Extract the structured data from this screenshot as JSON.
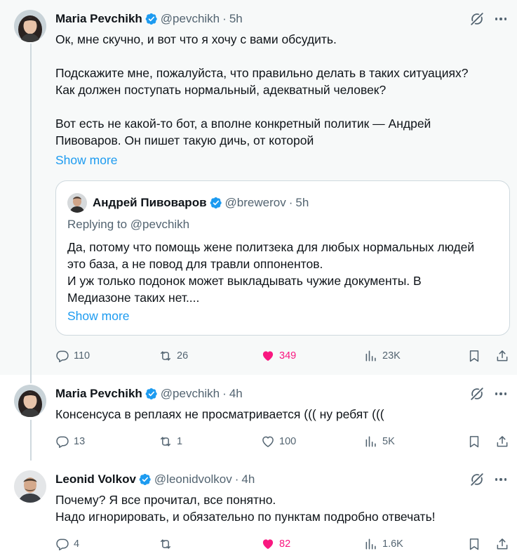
{
  "tweets": [
    {
      "author": {
        "name": "Maria Pevchikh",
        "handle": "@pevchikh",
        "time": "5h"
      },
      "text": {
        "p1": "Ок, мне скучно, и вот что я хочу с вами обсудить.",
        "p2a": "Подскажите мне, пожалуйста, что правильно делать в таких ситуациях?",
        "p2b": "Как должен поступать нормальный, адекватный человек?",
        "p3a": "Вот есть не какой-то бот, а вполне конкретный политик — Андрей",
        "p3b": "Пивоваров. Он пишет такую дичь, от которой"
      },
      "show_more": "Show more",
      "quote": {
        "author": {
          "name": "Андрей Пивоваров",
          "handle": "@brewerov",
          "time": "5h"
        },
        "replying_to": "Replying to @pevchikh",
        "lines": [
          "Да, потому что помощь жене политзека для любых нормальных людей",
          "это база, а не повод для травли оппонентов.",
          "И уж только подонок может выкладывать чужие документы. В",
          "Медиазоне таких нет...."
        ],
        "show_more": "Show more"
      },
      "stats": {
        "replies": "110",
        "reposts": "26",
        "likes": "349",
        "views": "23K"
      },
      "liked": true
    },
    {
      "author": {
        "name": "Maria Pevchikh",
        "handle": "@pevchikh",
        "time": "4h"
      },
      "text": {
        "p1": "Консенсуса в реплаях не просматривается ((( ну ребят ((("
      },
      "stats": {
        "replies": "13",
        "reposts": "1",
        "likes": "100",
        "views": "5K"
      },
      "liked": false
    },
    {
      "author": {
        "name": "Leonid Volkov",
        "handle": "@leonidvolkov",
        "time": "4h"
      },
      "text": {
        "p1": "Почему? Я все прочитал, все понятно.",
        "p2": "Надо игнорировать, и обязательно по пунктам подробно отвечать!"
      },
      "stats": {
        "replies": "4",
        "reposts": "",
        "likes": "82",
        "views": "1.6K"
      },
      "liked": true
    }
  ],
  "separator": "·",
  "colors": {
    "accent": "#1d9bf0",
    "like": "#f91880",
    "muted": "#536471",
    "border": "#cfd9de",
    "highlight_bg": "#f7f9f9"
  },
  "icons": [
    "verified-badge-icon",
    "grok-icon",
    "more-icon",
    "reply-icon",
    "repost-icon",
    "like-icon",
    "views-icon",
    "bookmark-icon",
    "share-icon"
  ]
}
